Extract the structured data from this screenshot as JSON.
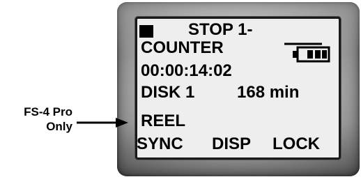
{
  "callout": {
    "line1": "FS-4 Pro",
    "line2": "Only"
  },
  "display": {
    "status": "STOP 1-",
    "counter_label": "COUNTER",
    "timecode": "00:00:14:02",
    "disk_label": "DISK 1",
    "disk_minutes": "168 min",
    "reel_label": "REEL",
    "battery_icon": "battery-icon"
  },
  "softkeys": [
    {
      "label": "SYNC"
    },
    {
      "label": "DISP"
    },
    {
      "label": "LOCK"
    }
  ],
  "colors": {
    "lcd_background": "#eeeeee",
    "text": "#000000",
    "bezel": "#a7a7a7"
  }
}
